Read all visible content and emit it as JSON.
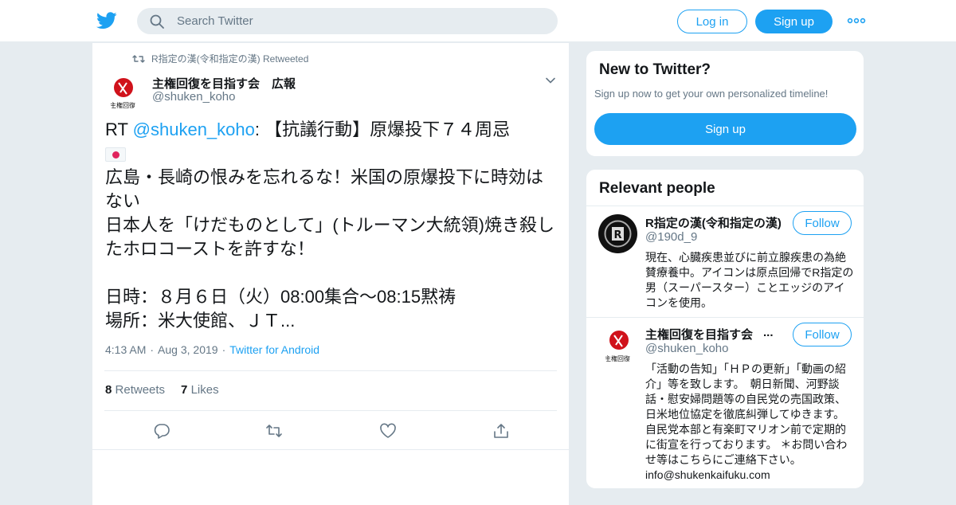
{
  "header": {
    "search_placeholder": "Search Twitter",
    "login_label": "Log in",
    "signup_label": "Sign up",
    "brand_color": "#1da1f2"
  },
  "tweet": {
    "retweeted_by": "R指定の漢(令和指定の漢) Retweeted",
    "author_name": "主権回復を目指す会　広報",
    "author_handle": "@shuken_koho",
    "text_prefix": "RT ",
    "text_mention": "@shuken_koho",
    "text_line1": ": 【抗議行動】原爆投下７４周忌",
    "text_body": "広島・長崎の恨みを忘れるな！米国の原爆投下に時効はない\n日本人を「けだものとして」(トルーマン大統領)焼き殺したホロコーストを許すな！\n\n日時：８月６日（火）08:00集合〜08:15黙祷\n場所：米大使館、ＪＴ...",
    "time": "4:13 AM",
    "date": "Aug 3, 2019",
    "source": "Twitter for Android",
    "retweets_count": "8",
    "retweets_label": "Retweets",
    "likes_count": "7",
    "likes_label": "Likes"
  },
  "new_to_twitter": {
    "title": "New to Twitter?",
    "subtitle": "Sign up now to get your own personalized timeline!",
    "button": "Sign up"
  },
  "relevant_people": {
    "title": "Relevant people",
    "people": [
      {
        "name": "R指定の漢(令和指定の漢)",
        "handle": "@190d_9",
        "follow": "Follow",
        "bio": "現在、心臓疾患並びに前立腺疾患の為絶賛療養中。アイコンは原点回帰でR指定の男（スーパースター）ことエッジのアイコンを使用。"
      },
      {
        "name": "主権回復を目指す会",
        "name_ellipsis": "...",
        "handle": "@shuken_koho",
        "follow": "Follow",
        "bio": "「活動の告知」「ＨＰの更新」「動画の紹介」等を致します。　朝日新聞、河野談話・慰安婦問題等の自民党の売国政策、日米地位協定を徹底糾弾してゆきます。　自民党本部と有楽町マリオン前で定期的に街宣を行っております。 ＊お問い合わせ等はこちらにご連絡下さい。info@shukenkaifuku.com"
      }
    ]
  }
}
